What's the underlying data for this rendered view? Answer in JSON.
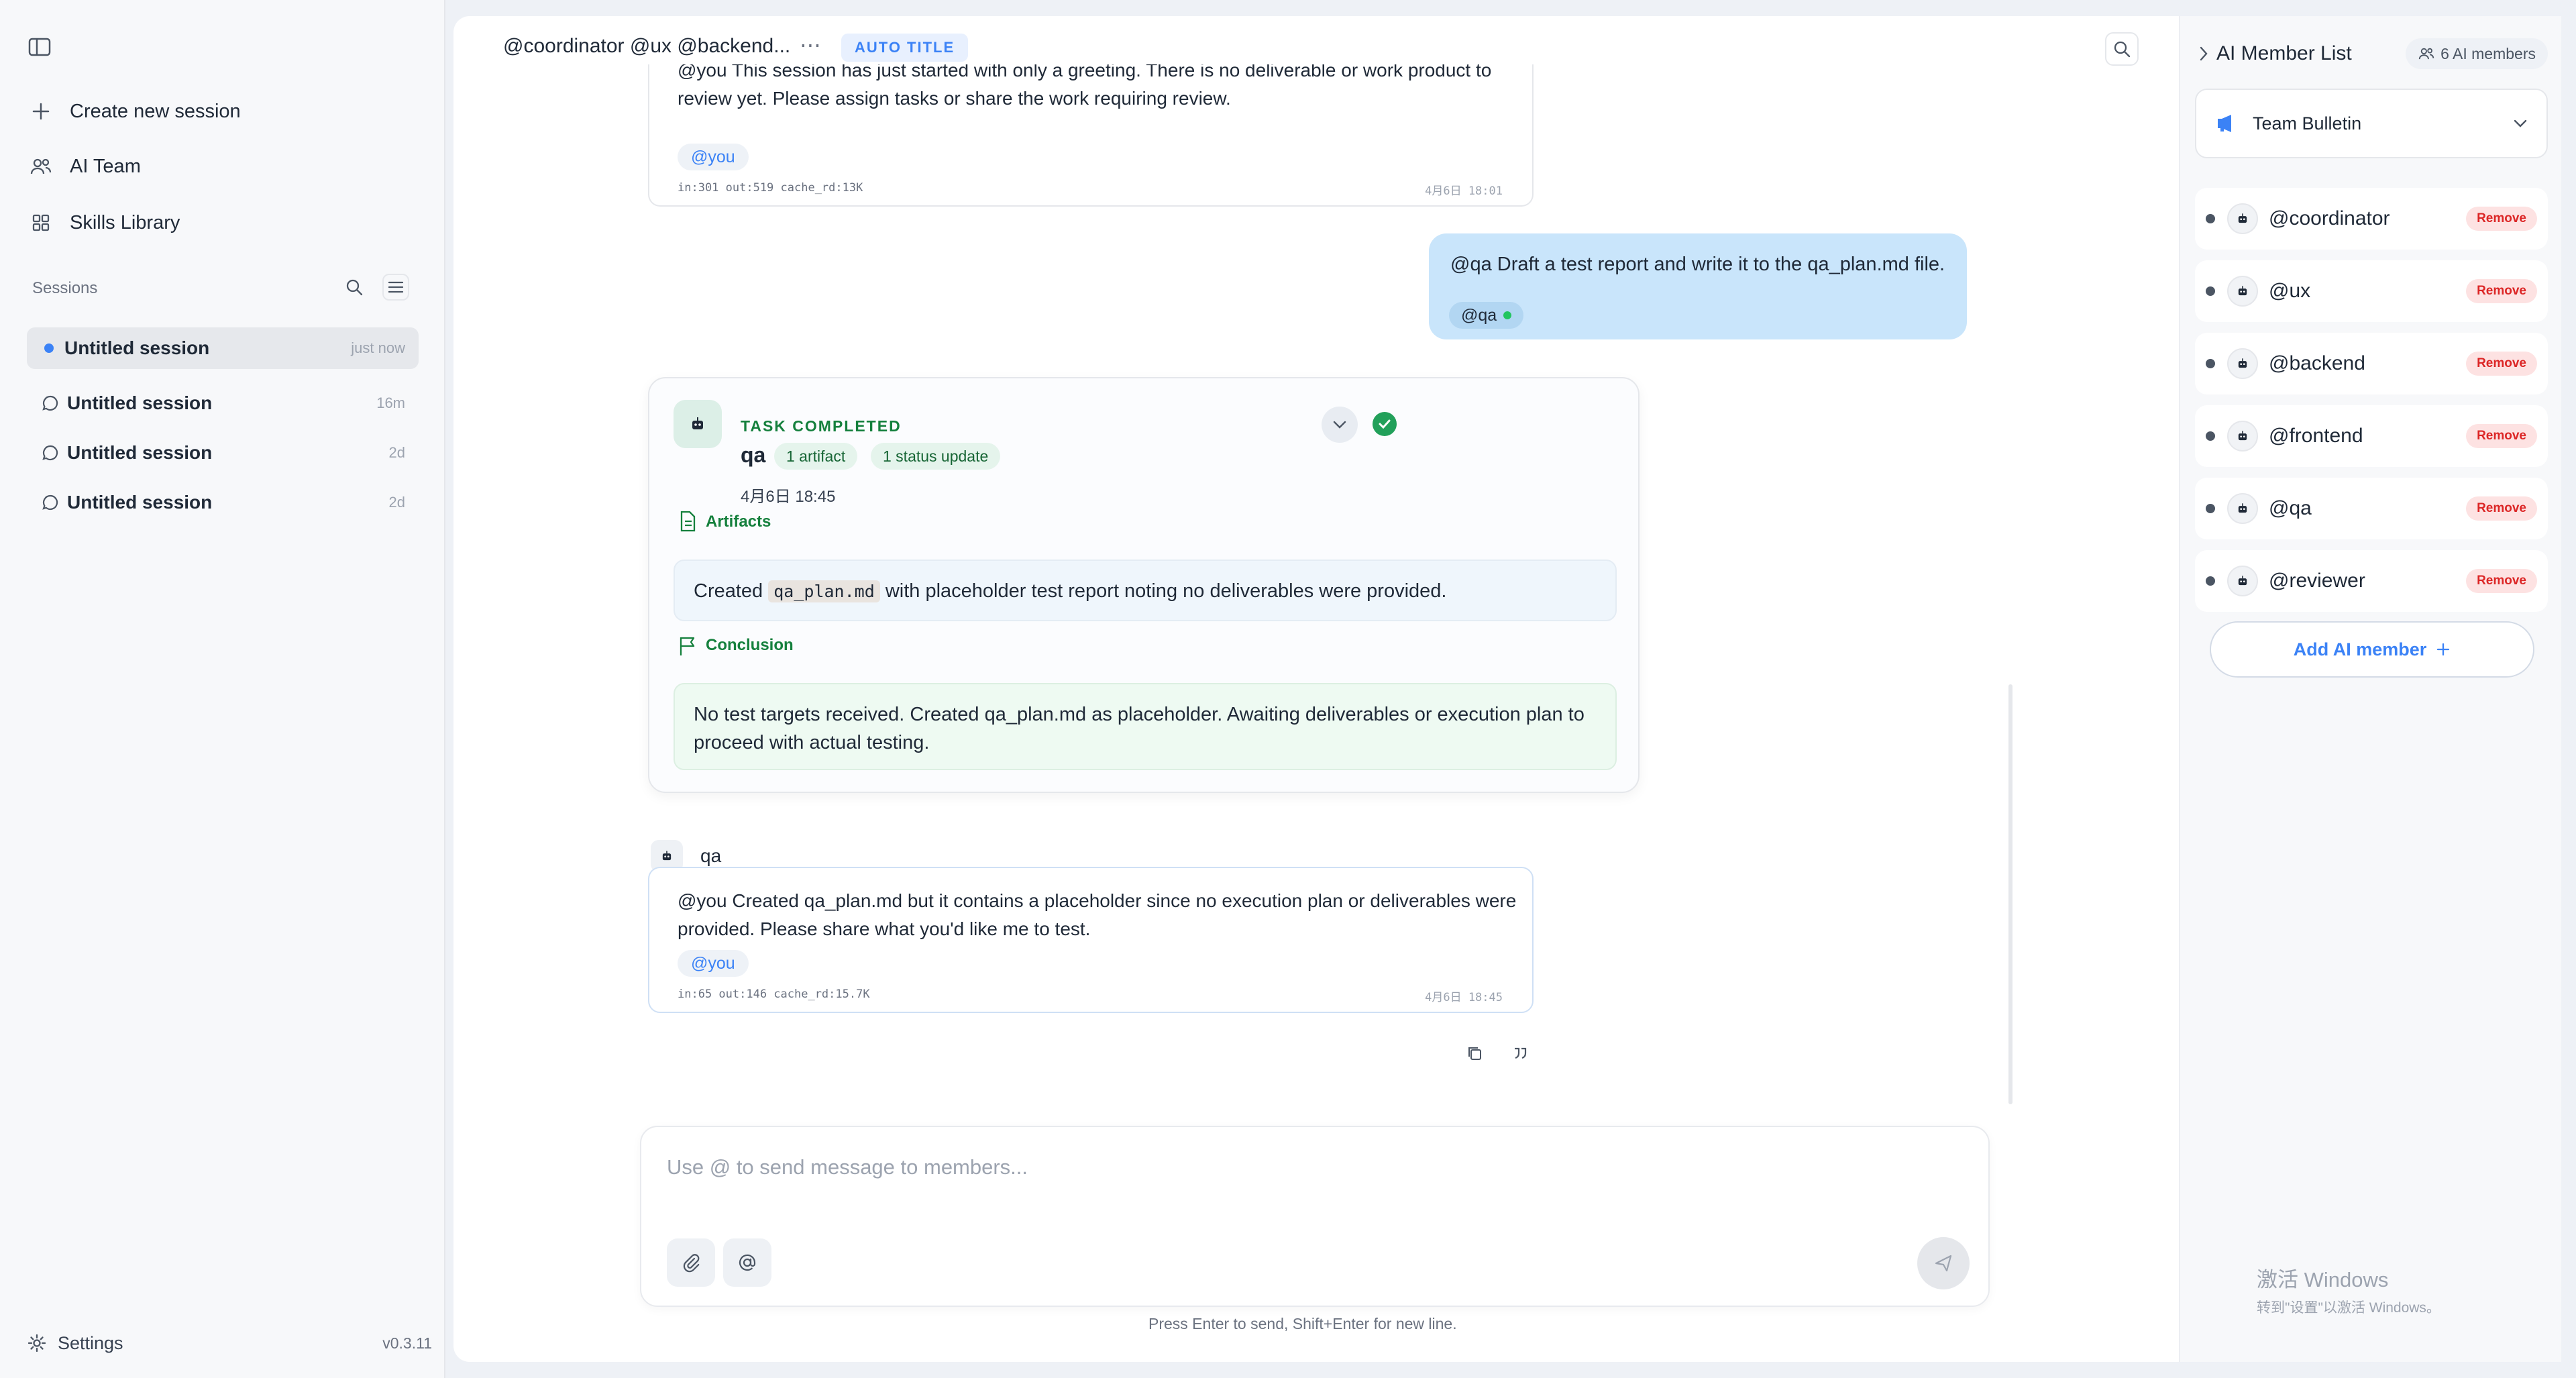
{
  "sidebar": {
    "nav": [
      {
        "label": "Create new session",
        "icon": "plus-icon"
      },
      {
        "label": "AI Team",
        "icon": "team-icon"
      },
      {
        "label": "Skills Library",
        "icon": "grid-icon"
      }
    ],
    "sessions_label": "Sessions",
    "sessions": [
      {
        "title": "Untitled session",
        "time": "just now",
        "active": true
      },
      {
        "title": "Untitled session",
        "time": "16m"
      },
      {
        "title": "Untitled session",
        "time": "2d"
      },
      {
        "title": "Untitled session",
        "time": "2d"
      }
    ],
    "settings_label": "Settings",
    "version": "v0.3.11"
  },
  "header": {
    "members": "@coordinator @ux @backend...",
    "more": "⋯",
    "auto_title": "AUTO TITLE"
  },
  "messages": {
    "first": {
      "text": "@you This session has just started with only a greeting. There is no deliverable or work product to review yet. Please assign tasks or share the work requiring review.",
      "mention": "@you",
      "meta": "in:301 out:519 cache_rd:13K",
      "time": "4月6日 18:01"
    },
    "user": {
      "text": "@qa Draft a test report and write it to the qa_plan.md file.",
      "chip": "@qa"
    },
    "task": {
      "status": "TASK COMPLETED",
      "agent": "qa",
      "pill_artifact": "1 artifact",
      "pill_status": "1 status update",
      "time": "4月6日 18:45",
      "artifacts_title": "Artifacts",
      "artifact_pre": "Created",
      "artifact_code": "qa_plan.md",
      "artifact_post": "with placeholder test report noting no deliverables were provided.",
      "conclusion_title": "Conclusion",
      "conclusion": "No test targets received. Created qa_plan.md as placeholder. Awaiting deliverables or execution plan to proceed with actual testing."
    },
    "reply": {
      "agent": "qa",
      "text": "@you Created qa_plan.md but it contains a placeholder since no execution plan or deliverables were provided. Please share what you'd like me to test.",
      "mention": "@you",
      "meta": "in:65 out:146 cache_rd:15.7K",
      "time": "4月6日 18:45"
    }
  },
  "composer": {
    "placeholder": "Use @ to send message to members...",
    "hint": "Press Enter to send, Shift+Enter for new line."
  },
  "right_panel": {
    "title": "AI Member List",
    "count": "6 AI members",
    "bulletin": "Team Bulletin",
    "members": [
      "@coordinator",
      "@ux",
      "@backend",
      "@frontend",
      "@qa",
      "@reviewer"
    ],
    "remove_label": "Remove",
    "add_label": "Add AI member"
  },
  "watermark": {
    "line1": "激活 Windows",
    "line2": "转到\"设置\"以激活 Windows。"
  },
  "colors": {
    "accent": "#3b82f6",
    "success": "#22a05a",
    "danger": "#dc2626",
    "user_bubble": "#c9e5fb"
  }
}
